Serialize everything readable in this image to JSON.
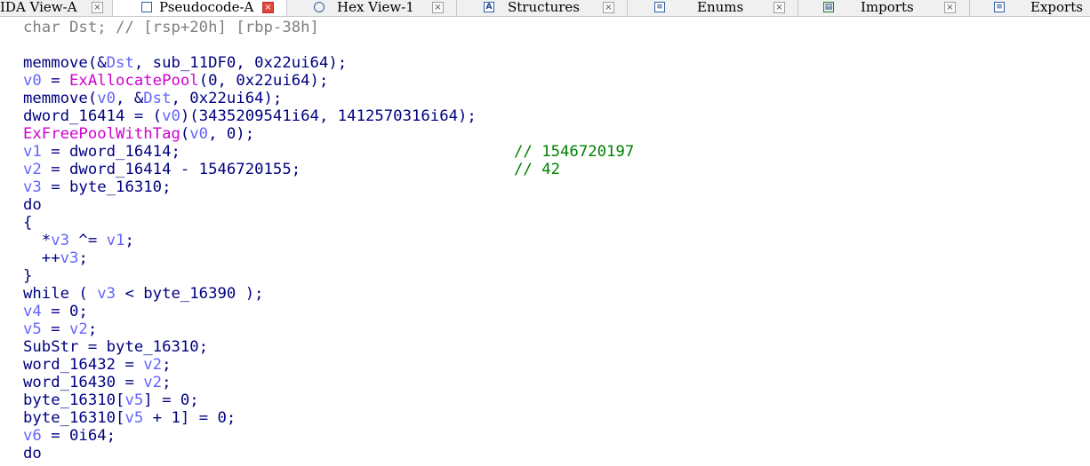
{
  "tabs": [
    {
      "label": "IDA View-A",
      "icon": "none",
      "active": false
    },
    {
      "label": "Pseudocode-A",
      "icon": "page-icon",
      "active": true
    },
    {
      "label": "Hex View-1",
      "icon": "hex-icon",
      "active": false
    },
    {
      "label": "Structures",
      "icon": "structures-icon",
      "active": false
    },
    {
      "label": "Enums",
      "icon": "enums-icon",
      "active": false
    },
    {
      "label": "Imports",
      "icon": "imports-icon",
      "active": false
    },
    {
      "label": "Exports",
      "icon": "exports-icon",
      "active": false
    }
  ],
  "close_glyph": "×",
  "colors": {
    "keyword": "#000080",
    "variable": "#6464ff",
    "gray": "#808080",
    "import": "#d000d0",
    "comment": "#008000",
    "active_close": "#e0453a"
  },
  "code": {
    "l0": [
      "char Dst; ",
      "// [rsp+20h] [rbp-38h]"
    ],
    "l2": [
      "memmove(&",
      "Dst",
      ", sub_11DF0, 0x22ui64);"
    ],
    "l3": [
      "v0",
      " = ",
      "ExAllocatePool",
      "(0, 0x22ui64);"
    ],
    "l4": [
      "memmove(",
      "v0",
      ", &",
      "Dst",
      ", 0x22ui64);"
    ],
    "l5": [
      "dword_16414 = (",
      "v0",
      ")(3435209541i64, 1412570316i64);"
    ],
    "l6": [
      "ExFreePoolWithTag",
      "(",
      "v0",
      ", 0);"
    ],
    "l7": [
      "v1",
      " = dword_16414;",
      "// 1546720197"
    ],
    "l8": [
      "v2",
      " = dword_16414 - 1546720155;",
      "// 42"
    ],
    "l9": [
      "v3",
      " = byte_16310;"
    ],
    "l10": "do",
    "l11": "{",
    "l12": [
      "  *",
      "v3",
      " ^= ",
      "v1",
      ";"
    ],
    "l13": [
      "  ++",
      "v3",
      ";"
    ],
    "l14": "}",
    "l15": [
      "while ( ",
      "v3",
      " < byte_16390 );"
    ],
    "l16": [
      "v4",
      " = 0;"
    ],
    "l17": [
      "v5",
      " = ",
      "v2",
      ";"
    ],
    "l18": "SubStr = byte_16310;",
    "l19": [
      "word_16432 = ",
      "v2",
      ";"
    ],
    "l20": [
      "word_16430 = ",
      "v2",
      ";"
    ],
    "l21": [
      "byte_16310[",
      "v5",
      "] = 0;"
    ],
    "l22": [
      "byte_16310[",
      "v5",
      " + 1] = 0;"
    ],
    "l23": [
      "v6",
      " = 0i64;"
    ],
    "l24": "do"
  }
}
